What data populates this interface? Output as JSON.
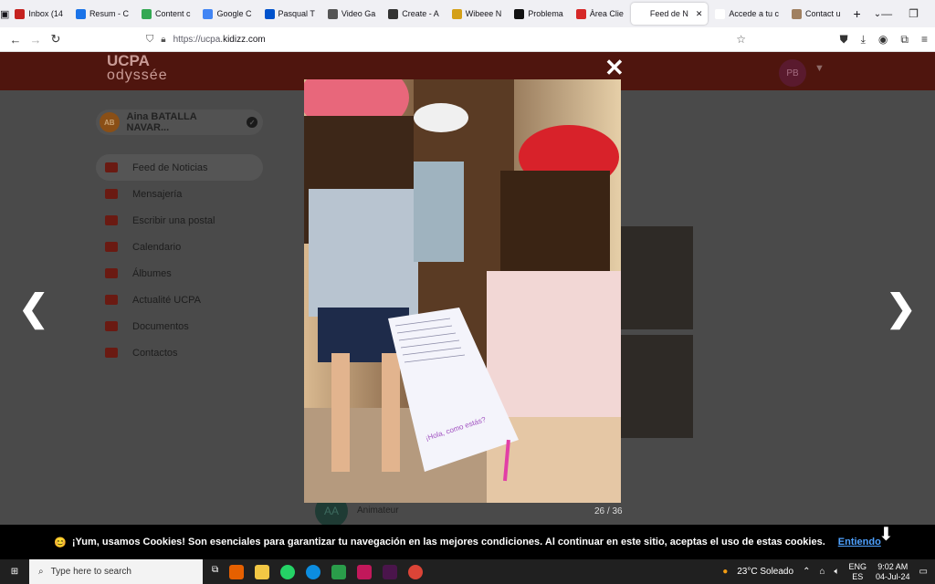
{
  "browser": {
    "tabs": [
      {
        "label": "Inbox (14",
        "color": "#c5221f"
      },
      {
        "label": "Resum - C",
        "color": "#1a73e8"
      },
      {
        "label": "Content c",
        "color": "#34a853"
      },
      {
        "label": "Google C",
        "color": "#4285f4"
      },
      {
        "label": "Pasqual T",
        "color": "#0052cc"
      },
      {
        "label": "Video Ga",
        "color": "#555555"
      },
      {
        "label": "Create - A",
        "color": "#333333"
      },
      {
        "label": "Wibeee N",
        "color": "#d4a017"
      },
      {
        "label": "Problema",
        "color": "#111111"
      },
      {
        "label": "Àrea Clie",
        "color": "#d62828"
      },
      {
        "label": "Feed de N",
        "color": "#ffffff",
        "active": true
      },
      {
        "label": "Accede a tu c",
        "color": "#ffffff"
      },
      {
        "label": "Contact u",
        "color": "#a08060"
      }
    ],
    "url_prefix": "https://ucpa.",
    "url_domain": "kidizz.com"
  },
  "site": {
    "logo_top": "UCPA",
    "logo_bottom": "odyssée",
    "avatar_initials": "PB",
    "user_initials": "AB",
    "user_name": "Aina BATALLA NAVAR...",
    "menu": [
      {
        "label": "Feed de Noticias",
        "active": true
      },
      {
        "label": "Mensajería"
      },
      {
        "label": "Escribir una postal"
      },
      {
        "label": "Calendario"
      },
      {
        "label": "Álbumes"
      },
      {
        "label": "Actualité UCPA"
      },
      {
        "label": "Documentos"
      },
      {
        "label": "Contactos"
      }
    ],
    "poster_initials": "AA",
    "poster_role": "Animateur"
  },
  "lightbox": {
    "counter": "26 / 36",
    "letter_text": "¡Hola, como estás?"
  },
  "cookie": {
    "emoji": "😊",
    "text": "¡Yum, usamos Cookies! Son esenciales para garantizar tu navegación en las mejores condiciones. Al continuar en este sitio, aceptas el uso de estas cookies.",
    "accept": "Entiendo"
  },
  "taskbar": {
    "search_placeholder": "Type here to search",
    "weather": "23°C  Soleado",
    "lang_top": "ENG",
    "lang_bottom": "ES",
    "time": "9:02 AM",
    "date": "04-Jul-24"
  }
}
